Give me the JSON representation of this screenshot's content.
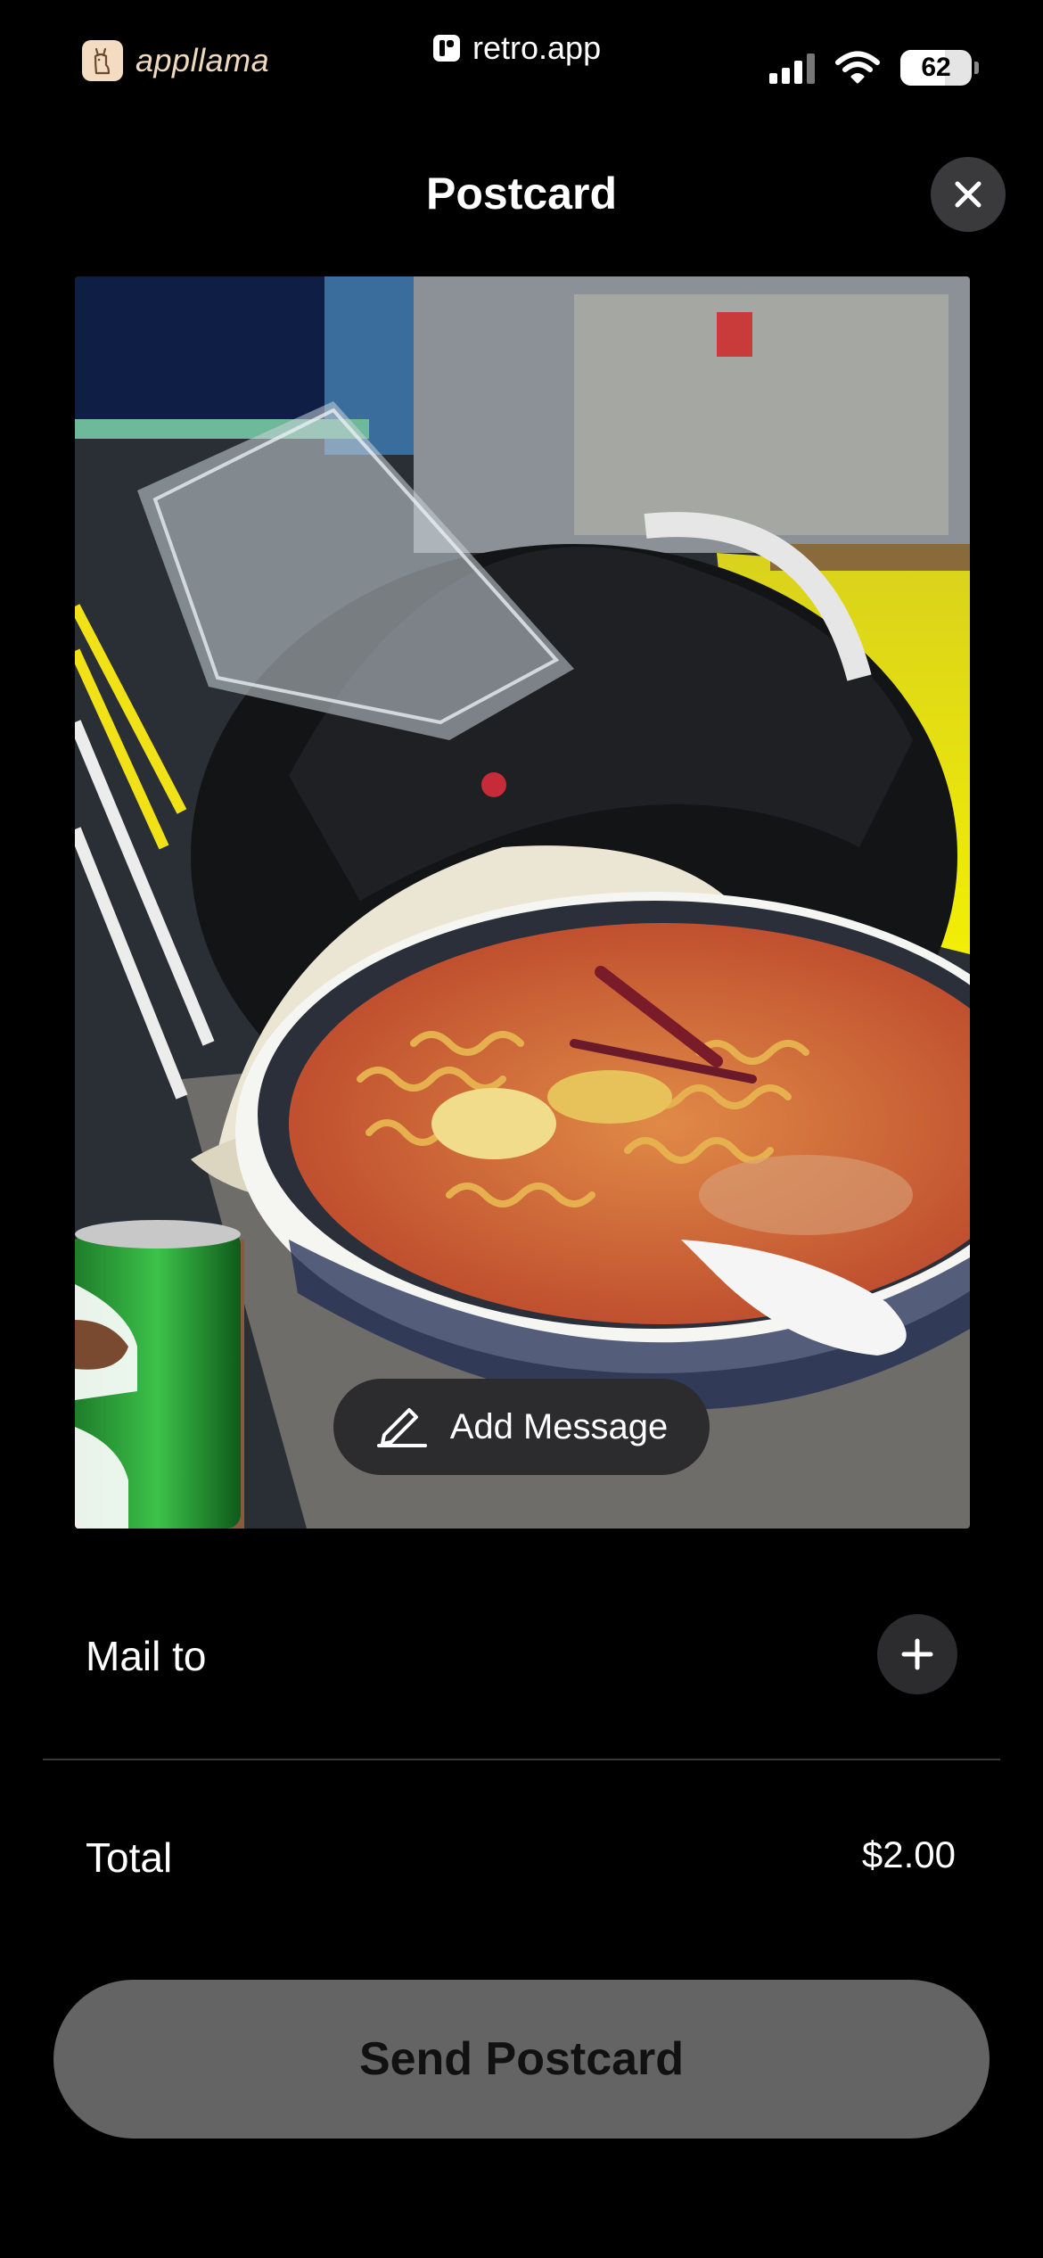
{
  "status_bar": {
    "brand": "appllama",
    "site": "retro.app",
    "battery": "62",
    "battery_level": 0.62
  },
  "header": {
    "title": "Postcard",
    "close_icon": "close-icon"
  },
  "photo": {
    "add_message_label": "Add Message",
    "add_message_icon": "pencil-icon"
  },
  "mail": {
    "label": "Mail to",
    "add_icon": "plus-icon"
  },
  "total": {
    "label": "Total",
    "value": "$2.00"
  },
  "actions": {
    "send_label": "Send Postcard"
  },
  "colors": {
    "background": "#000000",
    "button_surface": "#2c2c2e",
    "send_button": "#646464"
  }
}
